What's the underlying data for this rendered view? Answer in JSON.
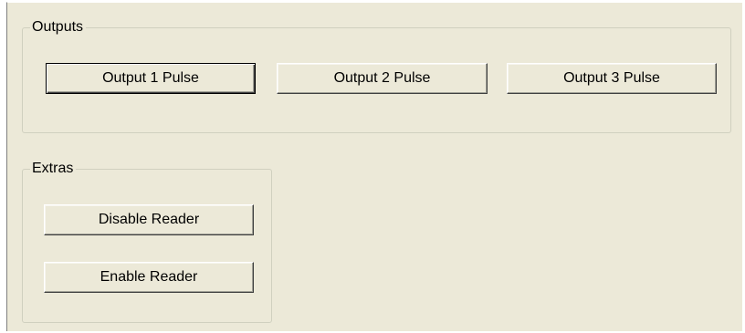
{
  "groups": {
    "outputs": {
      "title": "Outputs",
      "buttons": {
        "output1": "Output 1 Pulse",
        "output2": "Output 2 Pulse",
        "output3": "Output 3 Pulse"
      }
    },
    "extras": {
      "title": "Extras",
      "buttons": {
        "disable": "Disable Reader",
        "enable": "Enable Reader"
      }
    }
  },
  "colors": {
    "face": "#ece9d8",
    "groupbox_border": "#d0d0bf"
  }
}
